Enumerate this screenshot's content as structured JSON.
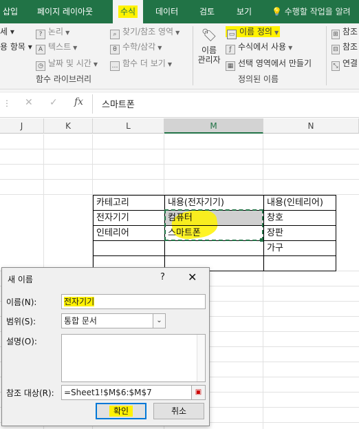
{
  "ribbon_tabs": [
    {
      "label": "삽입"
    },
    {
      "label": "페이지 레이아웃"
    },
    {
      "label": "수식"
    },
    {
      "label": "데이터"
    },
    {
      "label": "검토"
    },
    {
      "label": "보기"
    }
  ],
  "tell_me": "수행할 작업을 알려",
  "ribbon": {
    "function_library": {
      "items_col1": [
        "세 ▾",
        "용 항목 ▾"
      ],
      "items_col2": [
        "논리",
        "텍스트",
        "날짜 및 시간"
      ],
      "items_col3": [
        "찾기/참조 영역",
        "수학/삼각",
        "함수 더 보기"
      ],
      "group_label": "함수 라이브러리"
    },
    "defined_names": {
      "name_manager_line1": "이름",
      "name_manager_line2": "관리자",
      "define_name": "이름 정의",
      "use_in_formula": "수식에서 사용",
      "create_from_selection": "선택 영역에서 만들기",
      "group_label": "정의된 이름"
    },
    "formula_auditing": {
      "items": [
        "참조",
        "참조",
        "연결"
      ]
    }
  },
  "formula_bar": {
    "cancel": "✕",
    "enter": "✓",
    "fx": "fx",
    "content": "스마트폰"
  },
  "columns": [
    "J",
    "K",
    "L",
    "M",
    "N"
  ],
  "table": {
    "rows": [
      [
        "카테고리",
        "내용(전자기기)",
        "내용(인테리어)"
      ],
      [
        "전자기기",
        "컴퓨터",
        "창호"
      ],
      [
        "인테리어",
        "스마트폰",
        "장판"
      ],
      [
        "",
        "",
        "가구"
      ],
      [
        "",
        "",
        ""
      ]
    ]
  },
  "dialog": {
    "title": "새 이름",
    "help": "?",
    "close": "✕",
    "name_label": "이름(N):",
    "name_value": "전자기기",
    "scope_label": "범위(S):",
    "scope_value": "통합 문서",
    "comment_label": "설명(O):",
    "refers_label": "참조 대상(R):",
    "refers_value": "=Sheet1!$M$6:$M$7",
    "ok": "확인",
    "cancel": "취소"
  },
  "colors": {
    "excel_green": "#217346",
    "highlight": "#fff200"
  }
}
